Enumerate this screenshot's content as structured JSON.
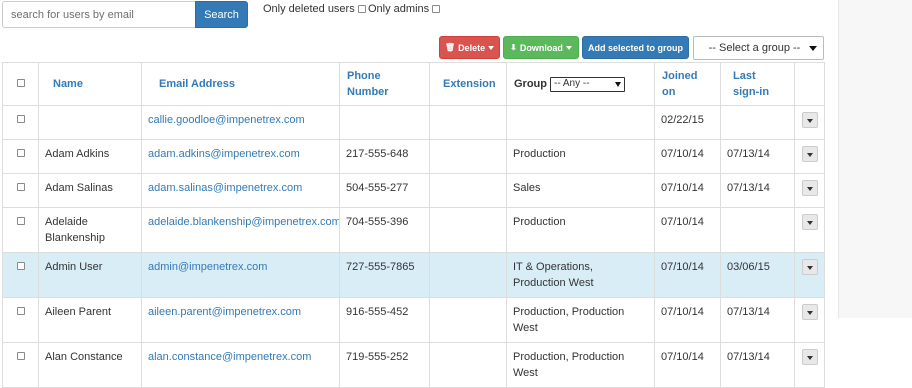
{
  "search": {
    "placeholder": "search for users by email",
    "value": "",
    "button_label": "Search"
  },
  "filters": {
    "only_deleted_label": "Only deleted users",
    "only_admins_label": "Only admins"
  },
  "toolbar": {
    "delete_label": "Delete",
    "download_label": "Download",
    "add_to_group_label": "Add selected to group",
    "group_select_value": "-- Select a group --"
  },
  "table": {
    "headers": {
      "name": "Name",
      "email": "Email Address",
      "phone": "Phone Number",
      "extension": "Extension",
      "group": "Group",
      "group_filter_value": "-- Any --",
      "joined": "Joined on",
      "last_sign_in": "Last sign-in"
    },
    "rows": [
      {
        "name": "",
        "email": "callie.goodloe@impenetrex.com",
        "phone": "",
        "extension": "",
        "group": "",
        "joined": "02/22/15",
        "last_sign_in": ""
      },
      {
        "name": "Adam Adkins",
        "email": "adam.adkins@impenetrex.com",
        "phone": "217-555-648",
        "extension": "",
        "group": "Production",
        "joined": "07/10/14",
        "last_sign_in": "07/13/14"
      },
      {
        "name": "Adam Salinas",
        "email": "adam.salinas@impenetrex.com",
        "phone": "504-555-277",
        "extension": "",
        "group": "Sales",
        "joined": "07/10/14",
        "last_sign_in": "07/13/14"
      },
      {
        "name": "Adelaide Blankenship",
        "email": "adelaide.blankenship@impenetrex.com",
        "phone": "704-555-396",
        "extension": "",
        "group": "Production",
        "joined": "07/10/14",
        "last_sign_in": ""
      },
      {
        "name": "Admin User",
        "email": "admin@impenetrex.com",
        "phone": "727-555-7865",
        "extension": "",
        "group": "IT & Operations, Production West",
        "joined": "07/10/14",
        "last_sign_in": "03/06/15"
      },
      {
        "name": "Aileen Parent",
        "email": "aileen.parent@impenetrex.com",
        "phone": "916-555-452",
        "extension": "",
        "group": "Production, Production West",
        "joined": "07/10/14",
        "last_sign_in": "07/13/14"
      },
      {
        "name": "Alan Constance",
        "email": "alan.constance@impenetrex.com",
        "phone": "719-555-252",
        "extension": "",
        "group": "Production, Production West",
        "joined": "07/10/14",
        "last_sign_in": "07/13/14"
      }
    ]
  },
  "colors": {
    "primary": "#337ab7",
    "danger": "#d9534f",
    "success": "#5cb85c",
    "row_highlight": "#d9edf7"
  },
  "icons": {
    "delete": "trash-icon",
    "download": "download-icon",
    "row_action": "chevron-down-icon"
  }
}
